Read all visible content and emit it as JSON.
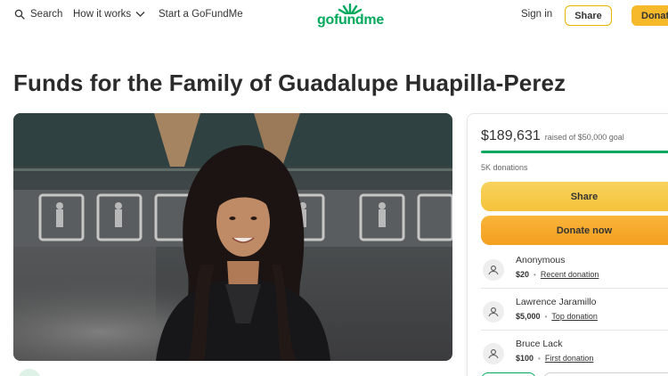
{
  "header": {
    "search_label": "Search",
    "how_it_works_label": "How it works",
    "start_label": "Start a GoFundMe",
    "logo_text": "gofundme",
    "signin_label": "Sign in",
    "share_label": "Share",
    "donate_label": "Donate"
  },
  "campaign": {
    "title": "Funds for the Family of Guadalupe Huapilla-Perez"
  },
  "card": {
    "raised_amount": "$189,631",
    "raised_goal": "raised of $50,000 goal",
    "progress_fraction": 1.0,
    "donation_count": "5K donations",
    "share_label": "Share",
    "donate_label": "Donate now",
    "donations": [
      {
        "name": "Anonymous",
        "amount": "$20",
        "tag": "Recent donation"
      },
      {
        "name": "Lawrence Jaramillo",
        "amount": "$5,000",
        "tag": "Top donation"
      },
      {
        "name": "Bruce Lack",
        "amount": "$100",
        "tag": "First donation"
      }
    ]
  },
  "colors": {
    "brand_green": "#02a95c",
    "share_yellow": "#f7c948",
    "donate_orange": "#f5a623"
  }
}
